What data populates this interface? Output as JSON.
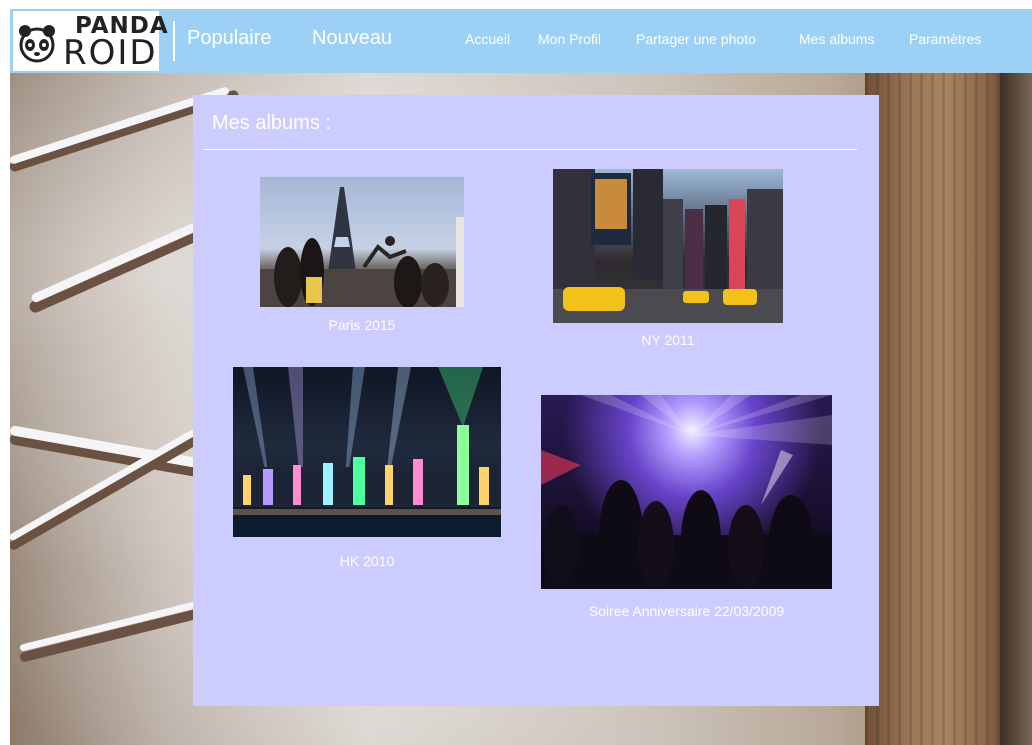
{
  "header": {
    "logo_alt": "PANDA ROID",
    "logo_word1": "PANDA",
    "logo_word2": "ROID",
    "nav_primary": [
      "Populaire",
      "Nouveau"
    ],
    "nav_secondary": [
      "Accueil",
      "Mon Profil",
      "Partager une photo",
      "Mes albums",
      "Paramètres"
    ]
  },
  "main": {
    "title": "Mes albums :",
    "albums": [
      {
        "caption": "Paris 2015"
      },
      {
        "caption": "NY 2011"
      },
      {
        "caption": "HK 2010"
      },
      {
        "caption": "Soiree Anniversaire 22/03/2009"
      }
    ]
  },
  "colors": {
    "topbar": "#9cd0f5",
    "panel": "#ccccff",
    "text": "#ffffff"
  },
  "icons": [
    "panda-logo-icon"
  ]
}
